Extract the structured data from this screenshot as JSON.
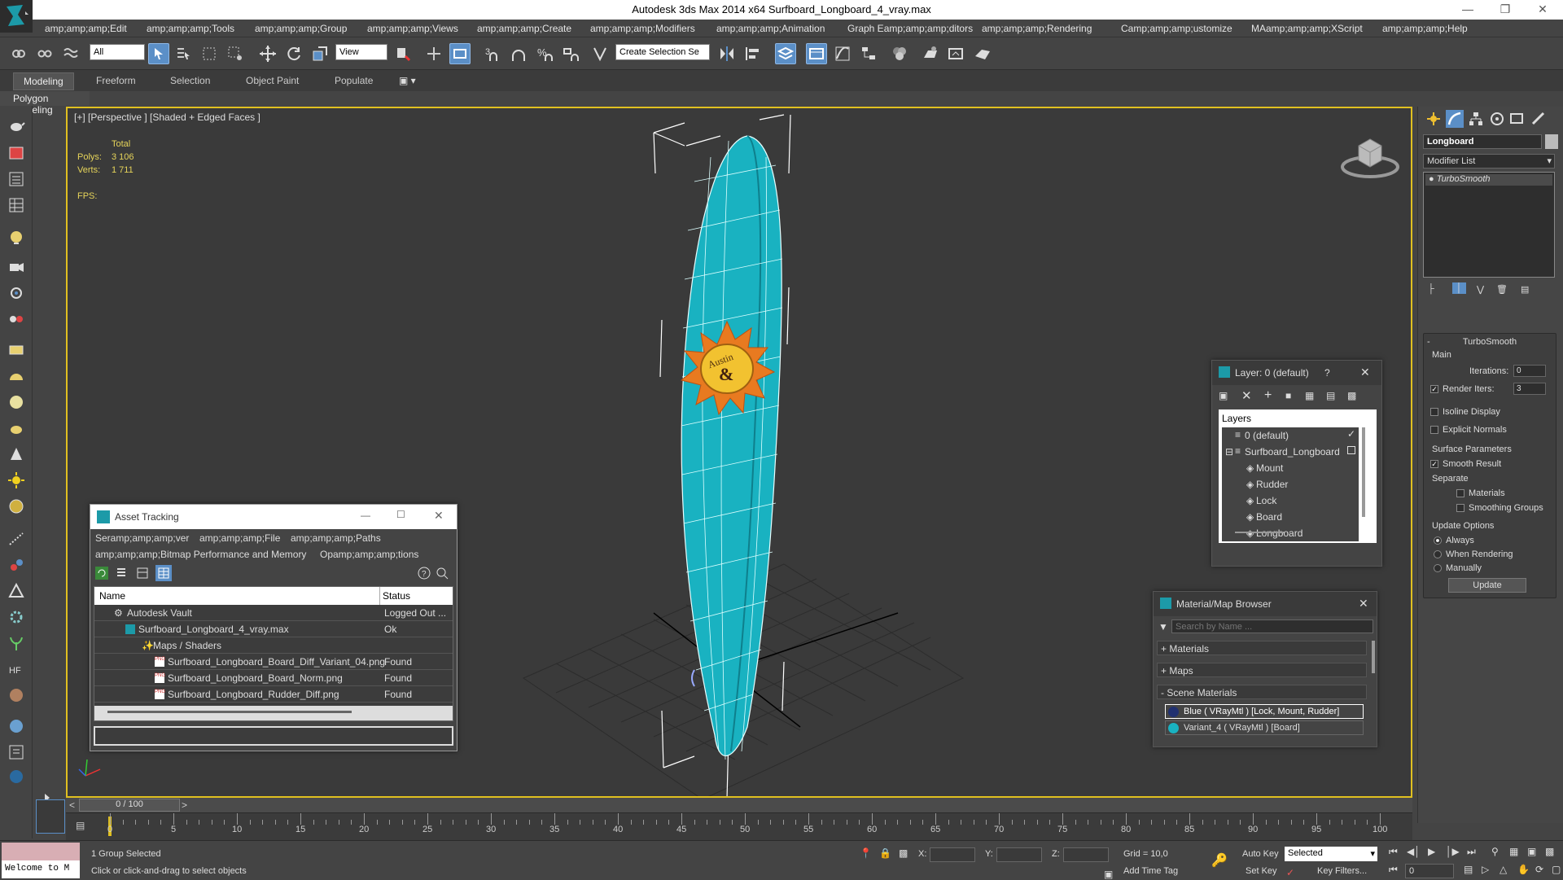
{
  "window": {
    "title": "Autodesk 3ds Max  2014 x64     Surfboard_Longboard_4_vray.max"
  },
  "menu": [
    "amp;amp;amp;Edit",
    "amp;amp;amp;Tools",
    "amp;amp;amp;Group",
    "amp;amp;amp;Views",
    "amp;amp;amp;Create",
    "amp;amp;amp;Modifiers",
    "amp;amp;amp;Animation",
    "Graph Eamp;amp;amp;ditors",
    "amp;amp;amp;Rendering",
    "Camp;amp;amp;ustomize",
    "MAamp;amp;amp;XScript",
    "amp;amp;amp;Help"
  ],
  "toolbar": {
    "filter": "All",
    "refcoord": "View",
    "selset": "Create Selection Se"
  },
  "ribbon": {
    "tabs": [
      "Modeling",
      "Freeform",
      "Selection",
      "Object Paint",
      "Populate"
    ],
    "subtitle": "Polygon Modeling"
  },
  "viewport": {
    "label": "[+] [Perspective ] [Shaded + Edged Faces ]",
    "stats_header": "Total",
    "polys_label": "Polys:",
    "polys_value": "3 106",
    "verts_label": "Verts:",
    "verts_value": "1 711",
    "fps_label": "FPS:",
    "decal_text": "Austin"
  },
  "command_panel": {
    "object_name": "Longboard",
    "modifier_list": "Modifier List",
    "stack_item": "TurboSmooth",
    "rollout": "TurboSmooth",
    "main": "Main",
    "iterations_label": "Iterations:",
    "iterations_value": "0",
    "render_iters_label": "Render Iters:",
    "render_iters_value": "3",
    "isoline": "Isoline Display",
    "explicit": "Explicit Normals",
    "surface": "Surface Parameters",
    "smooth_result": "Smooth Result",
    "separate": "Separate",
    "materials": "Materials",
    "smoothing_groups": "Smoothing Groups",
    "update_options": "Update Options",
    "always": "Always",
    "when_rendering": "When Rendering",
    "manually": "Manually",
    "update_button": "Update"
  },
  "asset_tracking": {
    "title": "Asset Tracking",
    "menu": [
      "Seramp;amp;amp;ver",
      "amp;amp;amp;File",
      "amp;amp;amp;Paths",
      "amp;amp;amp;Bitmap Performance and Memory",
      "Opamp;amp;amp;tions"
    ],
    "col_name": "Name",
    "col_status": "Status",
    "rows": [
      {
        "name": "Autodesk Vault",
        "status": "Logged Out ..."
      },
      {
        "name": "Surfboard_Longboard_4_vray.max",
        "status": "Ok"
      },
      {
        "name": "Maps / Shaders",
        "status": ""
      },
      {
        "name": "Surfboard_Longboard_Board_Diff_Variant_04.png",
        "status": "Found"
      },
      {
        "name": "Surfboard_Longboard_Board_Norm.png",
        "status": "Found"
      },
      {
        "name": "Surfboard_Longboard_Rudder_Diff.png",
        "status": "Found"
      }
    ]
  },
  "layers": {
    "title": "Layer: 0 (default)",
    "help": "?",
    "header": "Layers",
    "items": [
      "0 (default)",
      "Surfboard_Longboard",
      "Mount",
      "Rudder",
      "Lock",
      "Board",
      "Longboard"
    ]
  },
  "material_browser": {
    "title": "Material/Map Browser",
    "search_placeholder": "Search by Name ...",
    "materials": "+ Materials",
    "maps": "+ Maps",
    "scene_materials": "- Scene Materials",
    "items": [
      {
        "label": "Blue  ( VRayMtl ) [Lock, Mount, Rudder]",
        "color": "#cc0000"
      },
      {
        "label": "Variant_4  ( VRayMtl ) [Board]",
        "color": "#2e2e2e"
      }
    ]
  },
  "timeline": {
    "frame": "0 / 100",
    "ticks": [
      "0",
      "5",
      "10",
      "15",
      "20",
      "25",
      "30",
      "35",
      "40",
      "45",
      "50",
      "55",
      "60",
      "65",
      "70",
      "75",
      "80",
      "85",
      "90",
      "95",
      "100"
    ]
  },
  "status": {
    "welcome": "Welcome to M",
    "selected": "1 Group Selected",
    "prompt": "Click or click-and-drag to select objects",
    "x_label": "X:",
    "y_label": "Y:",
    "z_label": "Z:",
    "grid": "Grid = 10,0",
    "auto_key": "Auto Key",
    "set_key": "Set Key",
    "key_mode": "Selected",
    "key_filters": "Key Filters...",
    "add_time_tag": "Add Time Tag",
    "frame_value": "0"
  },
  "colors": {
    "board": "#19b2c1",
    "accent": "#5b8fc7",
    "viewport_border": "#e0c020"
  }
}
